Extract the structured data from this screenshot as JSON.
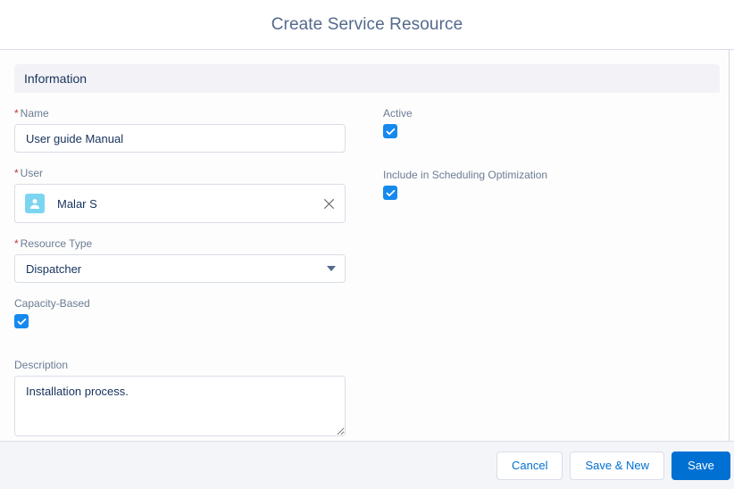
{
  "modal": {
    "title": "Create Service Resource"
  },
  "section": {
    "title": "Information"
  },
  "fields": {
    "name": {
      "label": "Name",
      "required_marker": "*",
      "value": "User guide Manual",
      "placeholder": ""
    },
    "user": {
      "label": "User",
      "required_marker": "*",
      "pill_label": "Malar S",
      "avatar_icon": "user-avatar-icon",
      "remove_icon": "close-icon"
    },
    "resource_type": {
      "label": "Resource Type",
      "required_marker": "*",
      "value": "Dispatcher",
      "arrow_icon": "chevron-down-icon",
      "options": [
        "Dispatcher"
      ]
    },
    "capacity_based": {
      "label": "Capacity-Based",
      "checked": true,
      "check_icon": "check-icon"
    },
    "description": {
      "label": "Description",
      "value": "Installation process.",
      "placeholder": ""
    },
    "active": {
      "label": "Active",
      "checked": true,
      "check_icon": "check-icon"
    },
    "include_in_scheduling_optimization": {
      "label": "Include in Scheduling Optimization",
      "checked": true,
      "check_icon": "check-icon"
    }
  },
  "footer": {
    "cancel_label": "Cancel",
    "save_new_label": "Save & New",
    "save_label": "Save"
  },
  "colors": {
    "brand_blue": "#0070d2",
    "checkbox_blue": "#1589ee",
    "required_red": "#c23934",
    "title_slate": "#54698d",
    "label_gray": "#6b7c93",
    "text_navy": "#16325c",
    "border_gray": "#d8dde6",
    "section_band": "#f3f3f7",
    "footer_bg": "#f4f5f9",
    "avatar_cyan": "#7cd5f0"
  }
}
